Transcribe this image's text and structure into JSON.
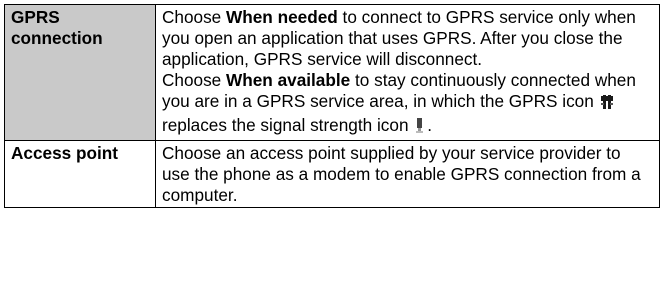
{
  "rows": [
    {
      "term": "GPRS connection",
      "paragraphs": [
        {
          "pre": "Choose ",
          "bold": "When needed",
          "post": " to connect to GPRS service only when you open an application that uses GPRS. After you close the application, GPRS service will disconnect."
        },
        {
          "pre": "Choose ",
          "bold": "When available",
          "post_a": " to stay continuously connected when you are in a GPRS service area, in which the GPRS icon ",
          "post_b": " replaces the signal strength icon ",
          "post_c": "."
        }
      ],
      "icons": [
        "gprs-icon",
        "signal-strength-icon"
      ]
    },
    {
      "term": "Access point",
      "paragraphs": [
        {
          "text": "Choose an access point supplied by your service provider to use the phone as a modem to enable GPRS connection from a computer."
        }
      ]
    }
  ],
  "colors": {
    "header_cell_bg": "#c9c9c9",
    "border": "#000000",
    "text": "#000000"
  }
}
